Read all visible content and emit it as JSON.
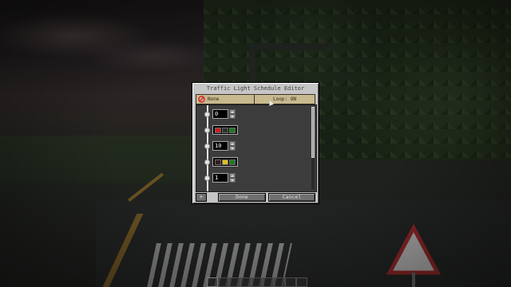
{
  "dialog": {
    "title": "Traffic Light Schedule Editor",
    "mode_label": "None",
    "loop_label": "Loop: ON",
    "done_label": "Done",
    "cancel_label": "Cancel",
    "add_label": "+"
  },
  "schedule": [
    {
      "kind": "delay",
      "value": "0"
    },
    {
      "kind": "lights",
      "lamps": [
        "#c82020",
        "#2f2f2f",
        "#1f7a1f"
      ]
    },
    {
      "kind": "delay",
      "value": "10"
    },
    {
      "kind": "lights",
      "lamps": [
        "#3a1a1a",
        "#e0c020",
        "#1f7a1f"
      ]
    },
    {
      "kind": "delay",
      "value": "1"
    }
  ],
  "colors": {
    "button_tan": "#c8b98f",
    "panel": "#c6c6c6",
    "list_bg": "#3c3c3c",
    "forbid_red": "#d22a2a"
  }
}
